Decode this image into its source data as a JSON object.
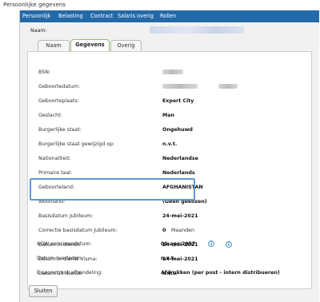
{
  "window": {
    "title": "Persoonlijke gegevens"
  },
  "menu": [
    "Persoonlijk",
    "Belasting",
    "Contract",
    "Salaris overig",
    "Rollen"
  ],
  "name_label": "Naam:",
  "tabs": [
    {
      "label": "Naam",
      "active": false
    },
    {
      "label": "Gegevens",
      "active": true
    },
    {
      "label": "Overig",
      "active": false
    }
  ],
  "fields": [
    {
      "label": "BSN:",
      "value": ""
    },
    {
      "label": "Geboortedatum:",
      "value": ""
    },
    {
      "label": "Geboorteplaats:",
      "value": "Expert City"
    },
    {
      "label": "Geslacht:",
      "value": "Man"
    },
    {
      "label": "Burgerlijke staat:",
      "value": "Ongehuwd"
    },
    {
      "label": "Burgerlijke staat gewijzigd op:",
      "value": "n.v.t."
    },
    {
      "label": "Nationaliteit:",
      "value": "Nederlandse"
    },
    {
      "label": "Primaire taal:",
      "value": "Nederlands"
    },
    {
      "label": "Geboorteland:",
      "value": "AFGHANISTAN"
    },
    {
      "label": "Woonland:",
      "value": "(Geen gekozen)"
    },
    {
      "label": "Basisdatum Jubileum:",
      "value": "24-mei-2021"
    },
    {
      "label": "Correctie basisdatum Jubileum:",
      "value": "0",
      "extra": "Maanden"
    },
    {
      "label": "Datum in dienst:",
      "value": "24-mei-2021",
      "info": "i"
    },
    {
      "label": "Datum in dienst Visma:",
      "value": "24-mei-2021"
    },
    {
      "label": "Datum uit dienst:",
      "value": "n.v.t."
    },
    {
      "label": "AOW-pensioendatum:",
      "value": "01-apr-2057",
      "info": "i"
    },
    {
      "label": "Datum overleden:",
      "value": "n.v.t."
    },
    {
      "label": "E-Loonstrook afhandeling:",
      "value": "Afdrukken (per post - intern distribueren)"
    }
  ],
  "buttons": {
    "close": "Sluiten"
  },
  "colors": {
    "menubar": "#2469a7",
    "highlight": "#5b9bd5",
    "active_tab": "#8cc45c"
  }
}
